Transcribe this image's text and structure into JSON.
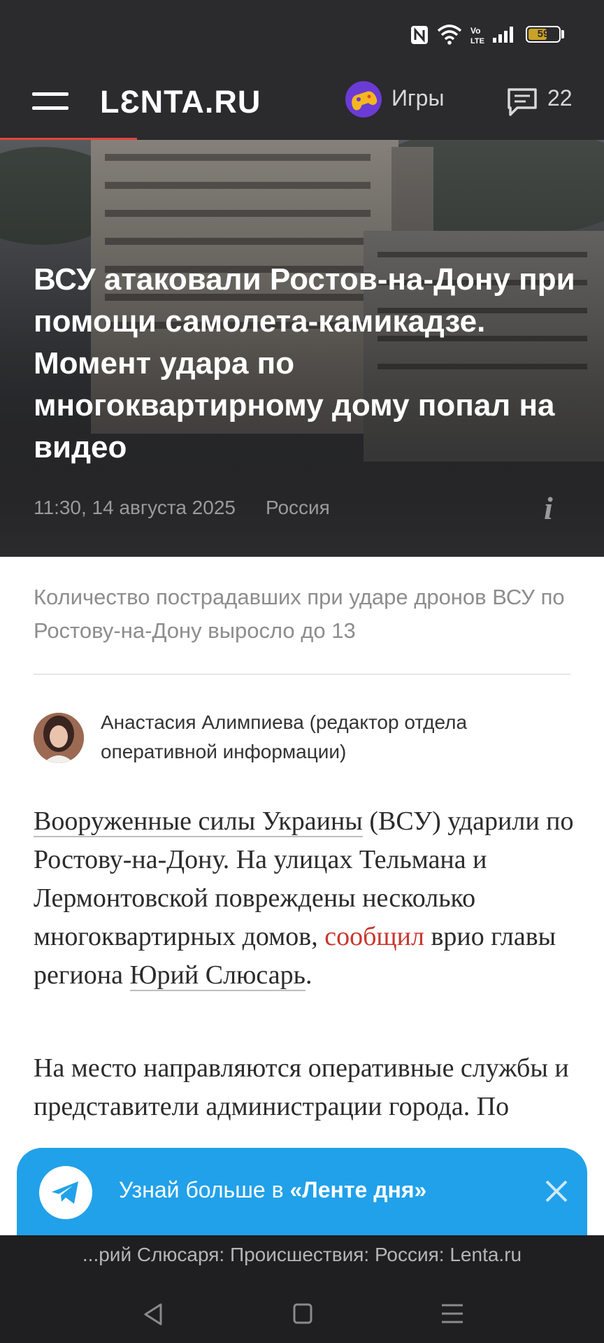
{
  "status_bar": {
    "icons": [
      "nfc-icon",
      "wifi-icon",
      "volte-icon",
      "signal-icon",
      "battery-icon"
    ],
    "battery_level": "59"
  },
  "header": {
    "logo": "LƐNTA.RU",
    "games_label": "Игры",
    "comments_count": "22"
  },
  "article": {
    "title": "ВСУ атаковали Ростов-на-Дону при помощи самолета-камикадзе. Момент удара по многоквартирному дому попал на видео",
    "date": "11:30, 14 августа 2025",
    "region": "Россия",
    "lead": "Количество пострадавших при ударе дронов ВСУ по Ростову-на-Дону выросло до 13",
    "author": "Анастасия Алимпиева (редактор отдела оперативной информации)",
    "p1": {
      "link1": "Вооруженные силы Украины",
      "t1": " (ВСУ) ударили по Ростову-на-Дону. На улицах Тельмана и Лермонтовской повреждены несколько многоквартирных домов, ",
      "link2": "сообщил",
      "t2": " врио главы региона ",
      "link3": "Юрий Слюсарь",
      "t3": "."
    },
    "p2": "На место направляются оперативные службы и представители администрации города. По"
  },
  "banner": {
    "prefix": "Узнай больше в ",
    "highlight": "«Ленте дня»"
  },
  "browser": {
    "url_title": "...рий Слюсаря: Происшествия: Россия: Lenta.ru"
  },
  "colors": {
    "header_bg": "#2b2a2c",
    "accent_red": "#e2453c",
    "link_red": "#c8362e",
    "banner_blue": "#21a1e9"
  }
}
